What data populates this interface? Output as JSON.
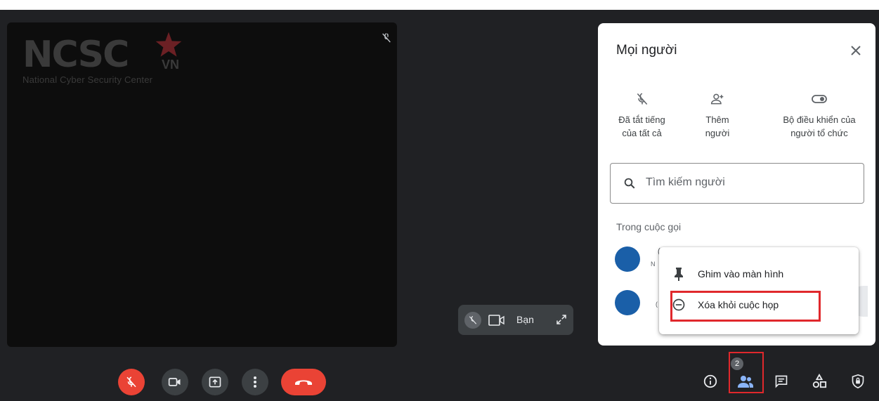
{
  "stage": {
    "logo_word": "NCSC",
    "logo_suffix": "VN",
    "logo_subtitle": "National Cyber Security Center"
  },
  "self_view": {
    "label": "Bạn"
  },
  "panel": {
    "title": "Mọi người",
    "actions": [
      {
        "line1": "Đã tắt tiếng",
        "line2": "của tất cả",
        "icon": "mic-off-icon"
      },
      {
        "line1": "Thêm",
        "line2": "người",
        "icon": "add-person-icon"
      },
      {
        "line1": "Bộ điều khiển của",
        "line2": "người tổ chức",
        "icon": "toggle-icon"
      }
    ],
    "search": {
      "placeholder": "Tìm kiếm người",
      "value": ""
    },
    "section_label": "Trong cuộc gọi",
    "participants": [
      {
        "name_partial": "(",
        "subtitle_partial": "N"
      },
      {
        "name_partial": "(",
        "subtitle_partial": ""
      }
    ]
  },
  "context_menu": {
    "items": [
      {
        "label": "Ghim vào màn hình",
        "icon": "pin-icon"
      },
      {
        "label": "Xóa khỏi cuộc họp",
        "icon": "remove-circle-icon",
        "highlighted": true
      }
    ]
  },
  "toolbar": {
    "buttons": [
      "mic-off-icon",
      "camera-icon",
      "present-icon",
      "more-icon",
      "end-call-icon"
    ]
  },
  "right_bar": {
    "people_count": "2",
    "icons": [
      "info-icon",
      "people-icon",
      "chat-icon",
      "activities-icon",
      "host-controls-icon"
    ]
  },
  "colors": {
    "background": "#202124",
    "stage": "#0d0d0d",
    "danger": "#ea4335",
    "highlight_box": "#e0282c",
    "avatar": "#1a5fa8",
    "toolbar_button": "#3c4043"
  }
}
